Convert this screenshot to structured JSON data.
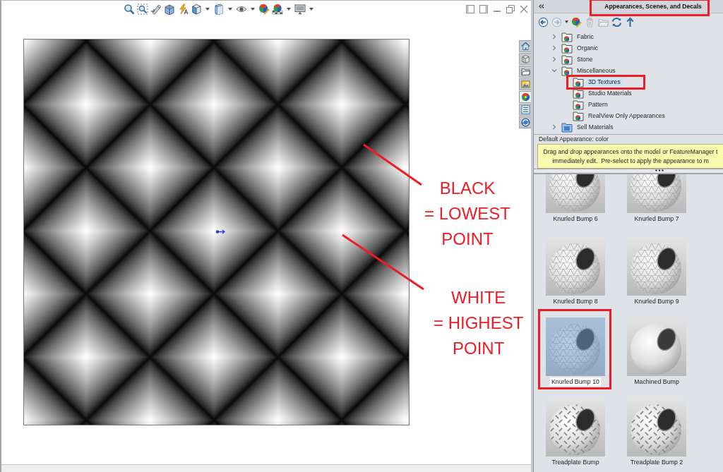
{
  "graphics_area": {
    "annotations": [
      {
        "lines": [
          "BLACK",
          "= LOWEST",
          "POINT"
        ]
      },
      {
        "lines": [
          "WHITE",
          "= HIGHEST",
          "POINT"
        ]
      }
    ]
  },
  "task_pane_tabs": [
    {
      "selected": false
    },
    {
      "selected": false
    },
    {
      "selected": false
    },
    {
      "selected": false
    },
    {
      "selected": true
    },
    {
      "selected": false
    },
    {
      "selected": false
    }
  ],
  "panel": {
    "title": "Appearances, Scenes, and Decals",
    "title_highlighted": true,
    "toolbar": [
      {
        "disabled": false
      },
      {
        "disabled": true
      },
      {
        "disabled": false
      },
      {
        "disabled": false
      },
      {
        "disabled": true
      },
      {
        "disabled": true
      },
      {
        "disabled": false
      },
      {
        "disabled": false
      }
    ],
    "tree": [
      {
        "label": "Fabric",
        "kind": "appearance",
        "expanded": false,
        "selected": false,
        "highlighted": false
      },
      {
        "label": "Organic",
        "kind": "appearance",
        "expanded": false,
        "selected": false,
        "highlighted": false
      },
      {
        "label": "Stone",
        "kind": "appearance",
        "expanded": false,
        "selected": false,
        "highlighted": false
      },
      {
        "label": "Miscellaneous",
        "kind": "appearance",
        "expanded": true,
        "selected": false,
        "highlighted": false,
        "children": [
          {
            "label": "3D Textures",
            "kind": "appearance",
            "selected": true,
            "highlighted": true
          },
          {
            "label": "Studio Materials",
            "kind": "appearance",
            "selected": false,
            "highlighted": false
          },
          {
            "label": "Pattern",
            "kind": "appearance",
            "selected": false,
            "highlighted": false
          },
          {
            "label": "RealView Only Appearances",
            "kind": "appearance",
            "selected": false,
            "highlighted": false
          }
        ]
      },
      {
        "label": "Sell Materials",
        "kind": "user",
        "expanded": false,
        "selected": false,
        "highlighted": false
      }
    ],
    "default_appearance": "Default Appearance: color",
    "hint_lines": [
      "Drag and drop appearances onto the model or FeatureManager t",
      "immediately edit.  Pre-select to apply the appearance to m"
    ],
    "appearances": [
      {
        "label": "Knurled Bump 6",
        "kind": "knurled",
        "selected": false,
        "highlighted": false
      },
      {
        "label": "Knurled Bump 7",
        "kind": "knurled",
        "selected": false,
        "highlighted": false
      },
      {
        "label": "Knurled Bump 8",
        "kind": "knurled",
        "selected": false,
        "highlighted": false
      },
      {
        "label": "Knurled Bump 9",
        "kind": "knurled",
        "selected": false,
        "highlighted": false
      },
      {
        "label": "Knurled Bump 10",
        "kind": "knurled",
        "selected": true,
        "highlighted": true
      },
      {
        "label": "Machined Bump",
        "kind": "machined",
        "selected": false,
        "highlighted": false
      },
      {
        "label": "Treadplate Bump",
        "kind": "treadplate",
        "selected": false,
        "highlighted": false
      },
      {
        "label": "Treadplate Bump 2",
        "kind": "treadplate",
        "selected": false,
        "highlighted": false
      }
    ]
  }
}
